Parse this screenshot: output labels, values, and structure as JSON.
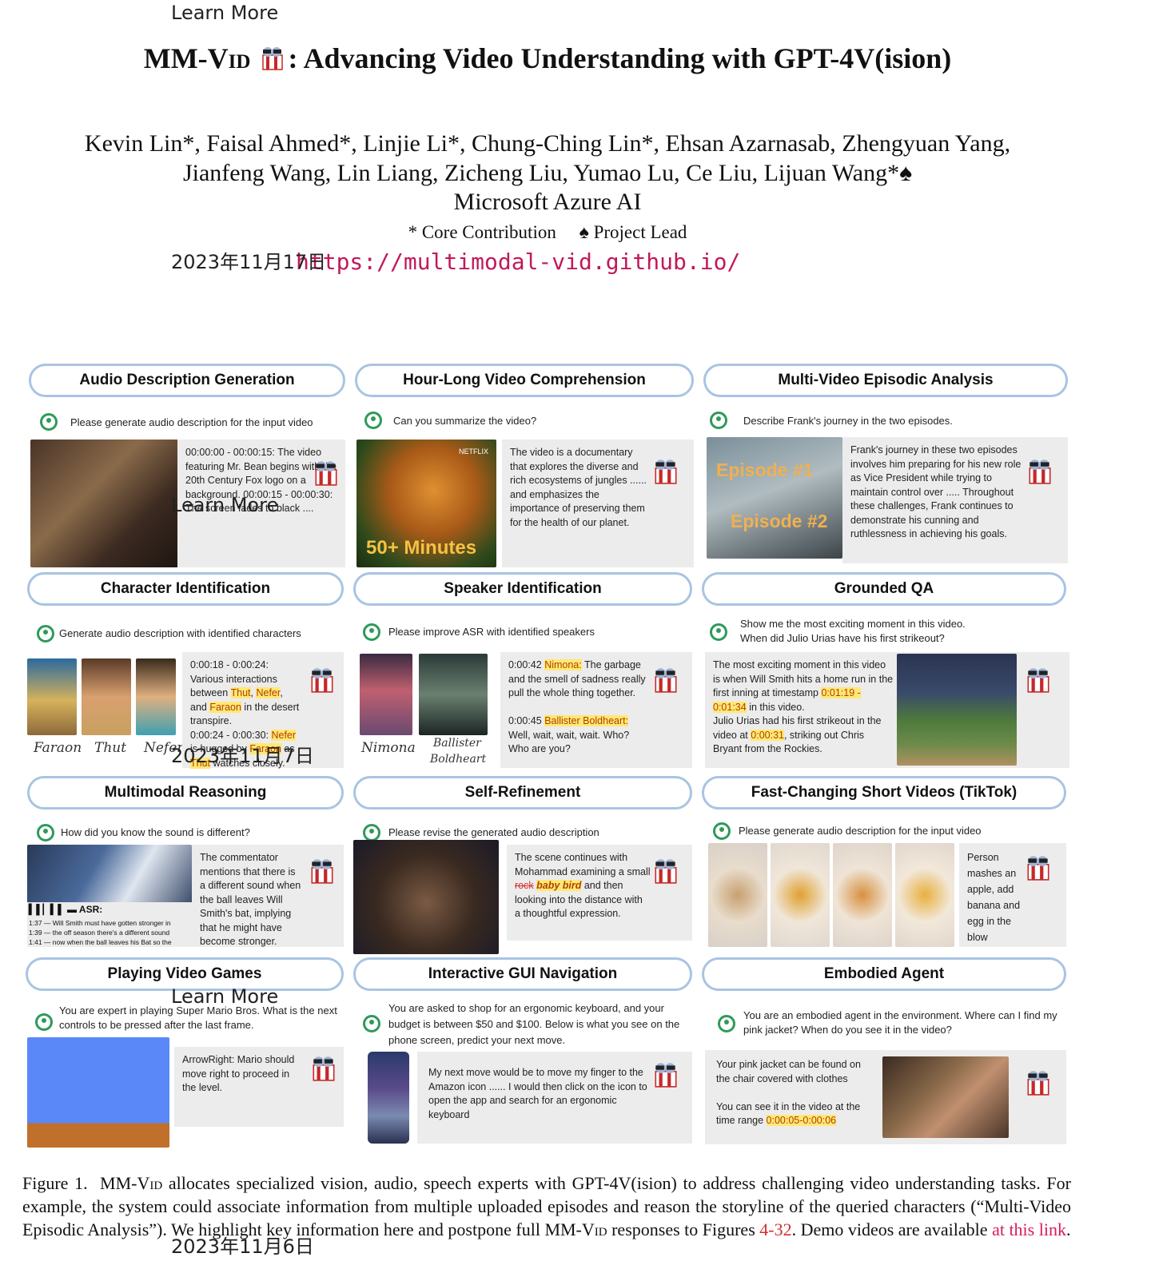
{
  "overlays": {
    "learn_more_1": "Learn More",
    "date_1": "2023年11月17日",
    "learn_more_2": "Learn More",
    "date_2": "2023年11月7日",
    "learn_more_3": "Learn More",
    "date_3": "2023年11月6日"
  },
  "header": {
    "title_name": "MM-Vid",
    "title_rest": ": Advancing Video Understanding with GPT-4V(ision)",
    "authors_line1": "Kevin Lin*, Faisal Ahmed*, Linjie Li*, Chung-Ching Lin*, Ehsan Azarnasab, Zhengyuan Yang,",
    "authors_line2": "Jianfeng Wang, Lin Liang, Zicheng Liu, Yumao Lu, Ce Liu, Lijuan Wang*♠",
    "affiliation": "Microsoft Azure AI",
    "footnote_core": "* Core Contribution",
    "footnote_lead": "♠ Project Lead",
    "url": "https://multimodal-vid.github.io/"
  },
  "panels": {
    "audio": {
      "title": "Audio Description Generation",
      "prompt": "Please generate audio description for the input video",
      "response": "00:00:00 - 00:00:15: The video featuring Mr. Bean begins with the 20th Century Fox logo on a background. 00:00:15 - 00:00:30: The screen fades to black ...."
    },
    "hourlong": {
      "title": "Hour-Long Video Comprehension",
      "prompt": "Can you summarize the video?",
      "image_text": "50+ Minutes",
      "image_brand": "NETFLIX",
      "response": "The video is a documentary that explores the diverse and rich ecosystems of jungles ...... and emphasizes the importance of preserving them for the health of our planet."
    },
    "multivideo": {
      "title": "Multi-Video Episodic Analysis",
      "prompt": "Describe Frank's journey in the two episodes.",
      "episode1": "Episode #1",
      "episode2": "Episode #2",
      "response": "Frank's journey in these two episodes involves him preparing for his new role as Vice President while trying to maintain control over ..... Throughout these challenges, Frank continues to demonstrate his cunning and ruthlessness in achieving his goals."
    },
    "character": {
      "title": "Character Identification",
      "prompt": "Generate audio description with identified characters",
      "labels": [
        "Faraon",
        "Thut",
        "Nefer"
      ],
      "r1": "0:00:18 - 0:00:24: Various interactions between ",
      "thut": "Thut",
      "nefer": "Nefer",
      "r2": "and ",
      "faraon": "Faraon",
      "r3": " in the desert transpire.",
      "r4": "0:00:24 - 0:00:30: ",
      "r5": " is hugged by ",
      "r6": " as ",
      "r7": " watches closely."
    },
    "speaker": {
      "title": "Speaker Identification",
      "prompt": "Please improve ASR with identified speakers",
      "labels": [
        "Nimona",
        "Ballister",
        "Boldheart"
      ],
      "t1": "0:00:42 ",
      "s1": "Nimona:",
      "q1": " The garbage and the smell of sadness really pull the whole thing together.",
      "t2": "0:00:45 ",
      "s2": "Ballister Boldheart:",
      "q2": " Well, wait, wait, wait. Who? Who are you?"
    },
    "grounded": {
      "title": "Grounded QA",
      "prompt1": "Show me the most exciting moment in this video.",
      "prompt2": "When did Julio Urias have his first strikeout?",
      "r1": "The most exciting moment in this video is when Will Smith hits a home run in the first inning at timestamp ",
      "ts1": "0:01:19 - 0:01:34",
      "r2": " in this video.",
      "r3": "Julio Urias had his first strikeout in the video at ",
      "ts2": "0:00:31",
      "r4": ", striking out Chris Bryant from the Rockies."
    },
    "reasoning": {
      "title": "Multimodal Reasoning",
      "prompt": "How did you know the sound is different?",
      "asr_label": "ASR:",
      "asr_lines": [
        "1:37 — Will Smith must have gotten stronger in",
        "1:39 — the off season there's a different sound",
        "1:41 — now when the ball leaves his Bat so the"
      ],
      "response": "The commentator mentions that there is a different sound when the ball leaves Will Smith's bat, implying that he might have become stronger."
    },
    "refine": {
      "title": "Self-Refinement",
      "prompt": "Please revise the generated audio description",
      "r1": "The scene continues with Mohammad examining a small ",
      "rock": "rock",
      "bird": "baby bird",
      "r2": " and then looking into the distance with a thoughtful expression."
    },
    "tiktok": {
      "title": "Fast-Changing Short Videos (TikTok)",
      "prompt": "Please generate audio description for the input video",
      "response": "Person mashes an apple, add banana and egg in the blow"
    },
    "games": {
      "title": "Playing Video Games",
      "prompt": "You are expert in playing Super Mario Bros. What is the next controls to be pressed after the last frame.",
      "response": "ArrowRight: Mario should move right to proceed in the level."
    },
    "gui": {
      "title": "Interactive GUI Navigation",
      "prompt": "You are asked to shop for an ergonomic keyboard, and your budget is between $50 and $100. Below is what you see on the phone  screen, predict your next move.",
      "response": "My next move would be to move my finger to the Amazon icon ...... I would then click on the icon to open the app and search for an ergonomic keyboard"
    },
    "embodied": {
      "title": "Embodied Agent",
      "prompt": "You are an embodied agent in the environment. Where can I find my pink jacket? When do you see it in the video?",
      "r1": "Your pink jacket can be found on the chair covered with clothes",
      "r2": "You can see it in the video at the time range ",
      "ts": "0:00:05-0:00:06"
    }
  },
  "caption": {
    "fig": "Figure 1.",
    "name": "MM-Vid",
    "p1": " allocates specialized vision, audio, speech experts with GPT-4V(ision) to address challenging video understanding tasks.  For example, the system could associate information from multiple uploaded episodes and reason the storyline of the queried characters (“Multi-Video Episodic Analysis”). We highlight key information here and postpone full ",
    "p2": " responses to Figures ",
    "figref": "4-32",
    "p3": ". Demo videos are available ",
    "link": "at this link",
    "p4": "."
  },
  "colors": {
    "pill_border": "#a9c4e3",
    "highlight": "#ffe873",
    "url": "#c2185b",
    "ref": "#d32f2f"
  }
}
